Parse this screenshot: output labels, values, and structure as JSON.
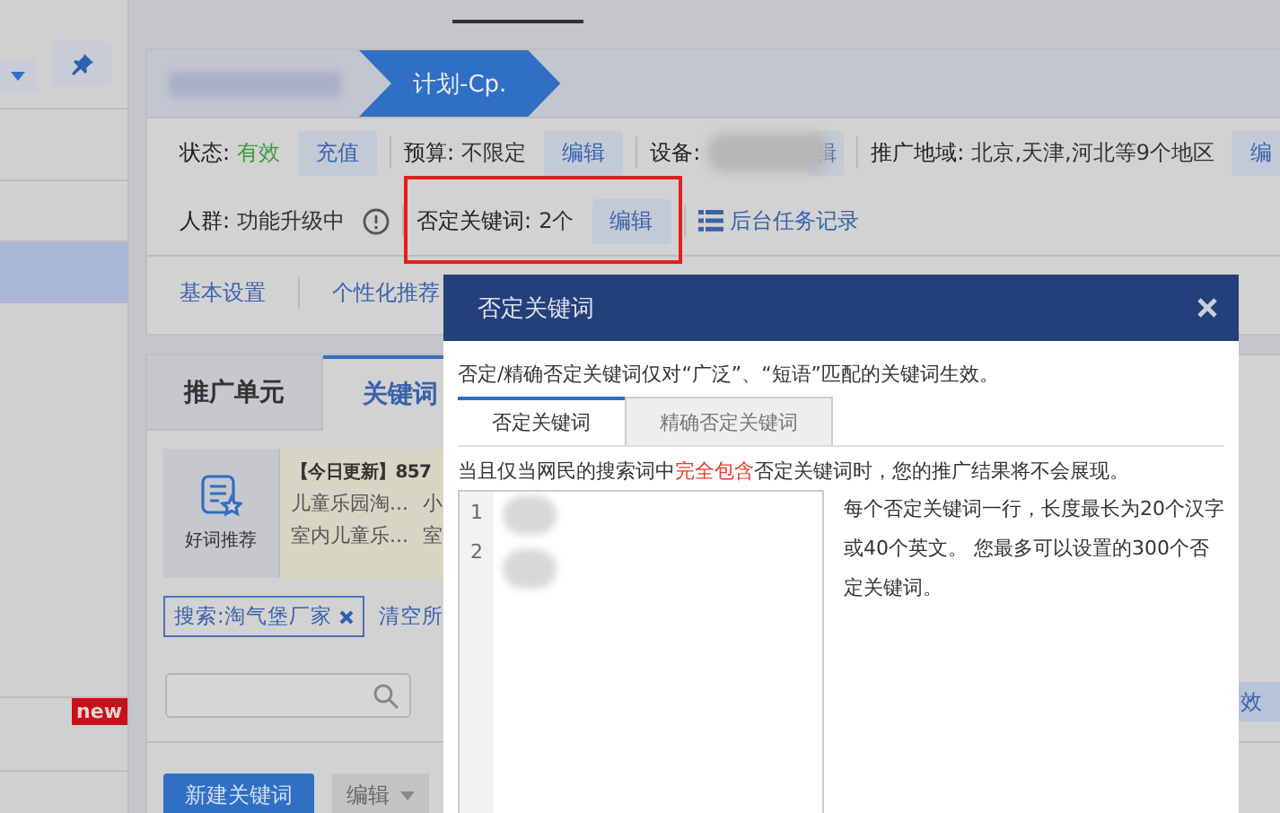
{
  "sidebar": {
    "rows": [
      {
        "selected": false
      },
      {
        "selected": false
      },
      {
        "selected": true
      },
      {
        "selected": false
      },
      {
        "selected": false,
        "badge": "new"
      }
    ]
  },
  "plan_header": {
    "current": "计划-Cp."
  },
  "info_rows": [
    [
      {
        "label": "状态:",
        "value": "有效",
        "kind": "status",
        "button": "充值"
      },
      {
        "label": "预算:",
        "value": "不限定",
        "kind": "plain",
        "button": "编辑"
      },
      {
        "label": "设备:",
        "kind": "blurred",
        "button": "辑"
      },
      {
        "label": "推广地域:",
        "value": "北京,天津,河北等9个地区",
        "kind": "plain",
        "button": "编"
      }
    ],
    [
      {
        "label": "人群:",
        "value": "功能升级中",
        "kind": "info"
      },
      {
        "label": "否定关键词:",
        "value": "2个",
        "kind": "plain",
        "button": "编辑",
        "highlighted": true
      },
      {
        "label": "后台任务记录",
        "kind": "link"
      }
    ]
  ],
  "page_tabs": [
    "基本设置",
    "个性化推荐"
  ],
  "sub_tabs": [
    {
      "label": "推广单元",
      "selected": false
    },
    {
      "label": "关键词",
      "selected": true
    }
  ],
  "recommend": {
    "label": "好词推荐",
    "headline": "【今日更新】857",
    "words": [
      [
        "儿童乐园淘...",
        "小"
      ],
      [
        "室内儿童乐...",
        "室"
      ]
    ]
  },
  "filter_tag": "搜索:淘气堡厂家",
  "clear_link": "清空所",
  "toolbar": {
    "buttons": [
      {
        "label": "新建关键词",
        "kind": "primary"
      },
      {
        "label": "编辑",
        "kind": "menu"
      }
    ],
    "side_button": "效"
  },
  "dialog": {
    "title": "否定关键词",
    "notice": "否定/精确否定关键词仅对“广泛”、“短语”匹配的关键词生效。",
    "tabs": [
      {
        "label": "否定关键词",
        "selected": true
      },
      {
        "label": "精确否定关键词",
        "selected": false
      }
    ],
    "rule": "当且仅当网民的搜索词中**完全包含**否定关键词时，您的推广结果将不会展现。",
    "line_numbers": [
      "1",
      "2"
    ],
    "help": "每个否定关键词一行，长度最长为20个汉字或40个英文。 您最多可以设置的300个否定关键词。"
  }
}
